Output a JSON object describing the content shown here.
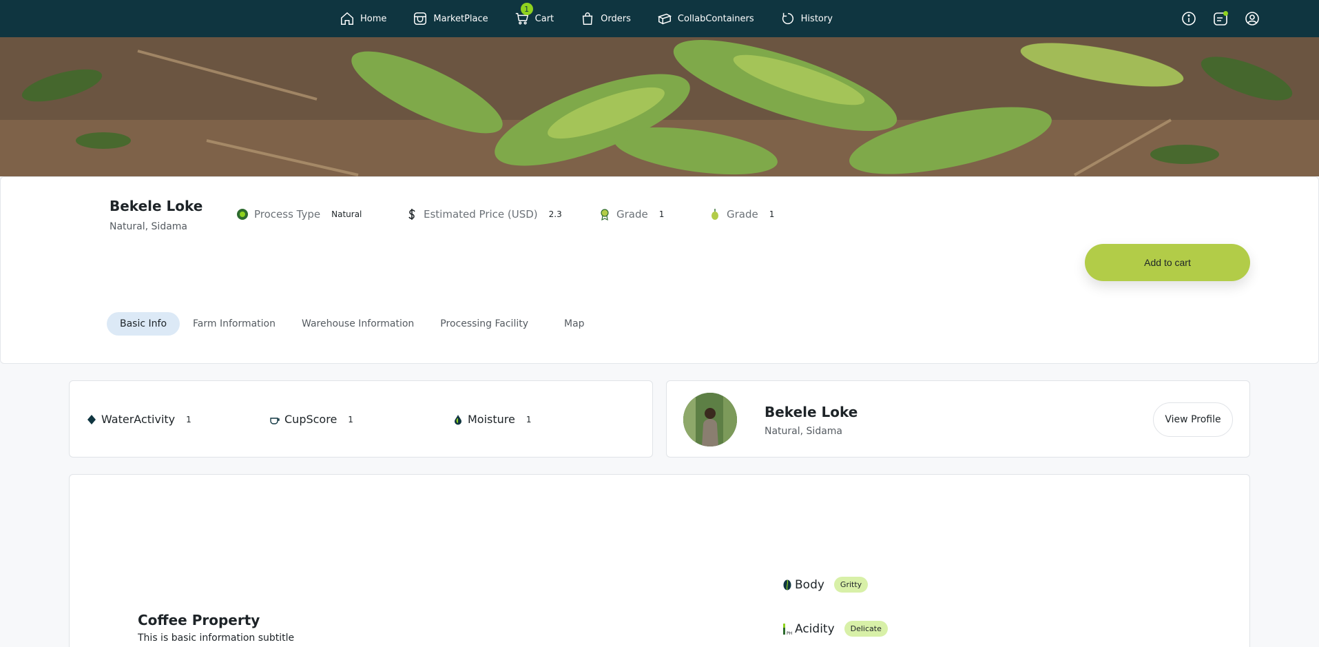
{
  "nav": {
    "items": [
      {
        "label": "Home"
      },
      {
        "label": "MarketPlace"
      },
      {
        "label": "Cart",
        "badge": "1"
      },
      {
        "label": "Orders"
      },
      {
        "label": "CollabContainers"
      },
      {
        "label": "History"
      }
    ]
  },
  "header": {
    "name": "Bekele Loke",
    "subtitle": "Natural, Sidama",
    "attributes": [
      {
        "label": "Process Type",
        "value": "Natural"
      },
      {
        "label": "Estimated Price (USD)",
        "value": "2.3"
      },
      {
        "label": "Grade",
        "value": "1"
      },
      {
        "label": "Grade",
        "value": "1"
      }
    ],
    "add_to_cart_label": "Add to cart",
    "tabs": [
      {
        "label": "Basic Info",
        "active": true
      },
      {
        "label": "Farm Information"
      },
      {
        "label": "Warehouse Information"
      },
      {
        "label": "Processing Facility"
      },
      {
        "label": "Map"
      }
    ]
  },
  "stats": [
    {
      "label": "WaterActivity",
      "value": "1"
    },
    {
      "label": "CupScore",
      "value": "1"
    },
    {
      "label": "Moisture",
      "value": "1"
    }
  ],
  "profile": {
    "name": "Bekele Loke",
    "subtitle": "Natural, Sidama",
    "button_label": "View Profile"
  },
  "property": {
    "title": "Coffee Property",
    "subtitle": "This is basic information subtitle",
    "rows": [
      {
        "label": "Body",
        "value": "Gritty"
      },
      {
        "label": "Acidity",
        "value": "Delicate"
      }
    ]
  },
  "colors": {
    "nav_bg": "#0f3540",
    "accent_green": "#b2cc48",
    "badge_green": "#8fd21f",
    "pill_bg": "#d8f0a8",
    "tab_active_bg": "#dce9f6"
  }
}
